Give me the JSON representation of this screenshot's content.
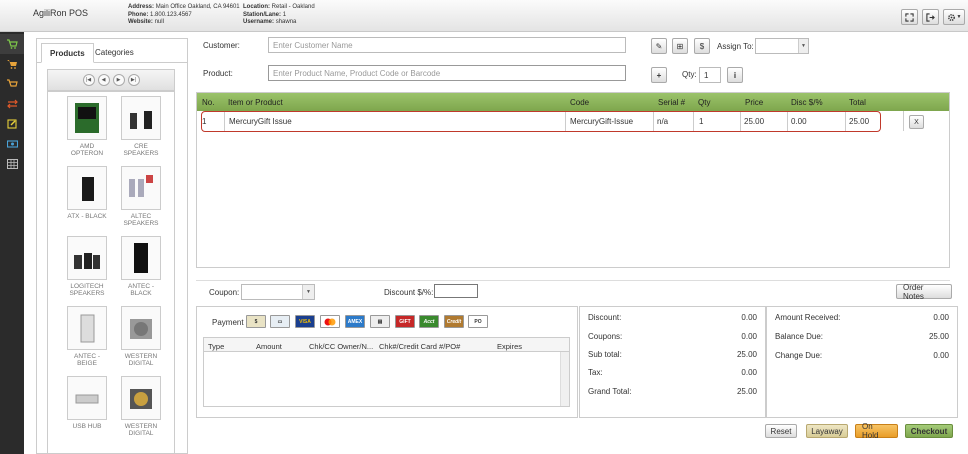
{
  "header": {
    "app_title": "AgiliRon POS",
    "address_label": "Address:",
    "address_value": "Main Office Oakland, CA 94601",
    "phone_label": "Phone:",
    "phone_value": "1.800.123.4567",
    "website_label": "Website:",
    "website_value": "null",
    "location_label": "Location:",
    "location_value": "Retail - Oakland",
    "station_label": "Station/Lane:",
    "station_value": "1",
    "username_label": "Username:",
    "username_value": "shawna"
  },
  "sidebar": {
    "icons": [
      "home-icon",
      "cart-icon",
      "cart-outline-icon",
      "transfer-icon",
      "edit-icon",
      "cash-icon",
      "table-icon"
    ]
  },
  "left_panel": {
    "tabs": [
      "Products",
      "Categories"
    ],
    "active_tab": "Products",
    "products": [
      {
        "name": "AMD OPTERON"
      },
      {
        "name": "CRE SPEAKERS"
      },
      {
        "name": "ATX - BLACK"
      },
      {
        "name": "ALTEC SPEAKERS"
      },
      {
        "name": "LOGITECH SPEAKERS"
      },
      {
        "name": "ANTEC - BLACK"
      },
      {
        "name": "ANTEC - BEIGE"
      },
      {
        "name": "WESTERN DIGITAL"
      },
      {
        "name": "USB HUB"
      },
      {
        "name": "WESTERN DIGITAL"
      }
    ]
  },
  "customer": {
    "label": "Customer:",
    "placeholder": "Enter Customer Name",
    "assign_label": "Assign To:"
  },
  "product_entry": {
    "label": "Product:",
    "placeholder": "Enter Product Name, Product Code or Barcode",
    "qty_label": "Qty:",
    "qty_value": "1"
  },
  "line_items": {
    "headers": [
      "No.",
      "Item or Product",
      "Code",
      "Serial #",
      "Qty",
      "Price",
      "Disc $/%",
      "Total"
    ],
    "rows": [
      {
        "no": "1",
        "item": "MercuryGift Issue",
        "code": "MercuryGift-Issue",
        "serial": "n/a",
        "qty": "1",
        "price": "25.00",
        "disc": "0.00",
        "total": "25.00"
      }
    ],
    "remove_label": "X"
  },
  "coupon": {
    "label": "Coupon:",
    "discount_label": "Discount $/%:",
    "order_notes_label": "Order Notes"
  },
  "payment": {
    "label": "Payment",
    "methods": [
      "Cash",
      "Check",
      "VISA",
      "MC",
      "AMEX",
      "Card",
      "GIFT",
      "Acct",
      "Credit",
      "PO"
    ],
    "headers": [
      "Type",
      "Amount",
      "Chk/CC Owner/N...",
      "Chk#/Credit Card #/PO#",
      "Expires"
    ]
  },
  "totals": {
    "discount_label": "Discount:",
    "discount_value": "0.00",
    "coupons_label": "Coupons:",
    "coupons_value": "0.00",
    "subtotal_label": "Sub total:",
    "subtotal_value": "25.00",
    "tax_label": "Tax:",
    "tax_value": "0.00",
    "grand_label": "Grand Total:",
    "grand_value": "25.00"
  },
  "balance": {
    "received_label": "Amount Received:",
    "received_value": "0.00",
    "due_label": "Balance Due:",
    "due_value": "25.00",
    "change_label": "Change Due:",
    "change_value": "0.00"
  },
  "actions": {
    "reset": "Reset",
    "layaway": "Layaway",
    "on_hold": "On Hold",
    "checkout": "Checkout"
  },
  "colors": {
    "header_green": "#8db55c",
    "highlight_red": "#c0392b",
    "sidebar_dark": "#2b2b2b",
    "checkout_green": "#7ea64d",
    "on_hold_orange": "#f2a93b"
  }
}
